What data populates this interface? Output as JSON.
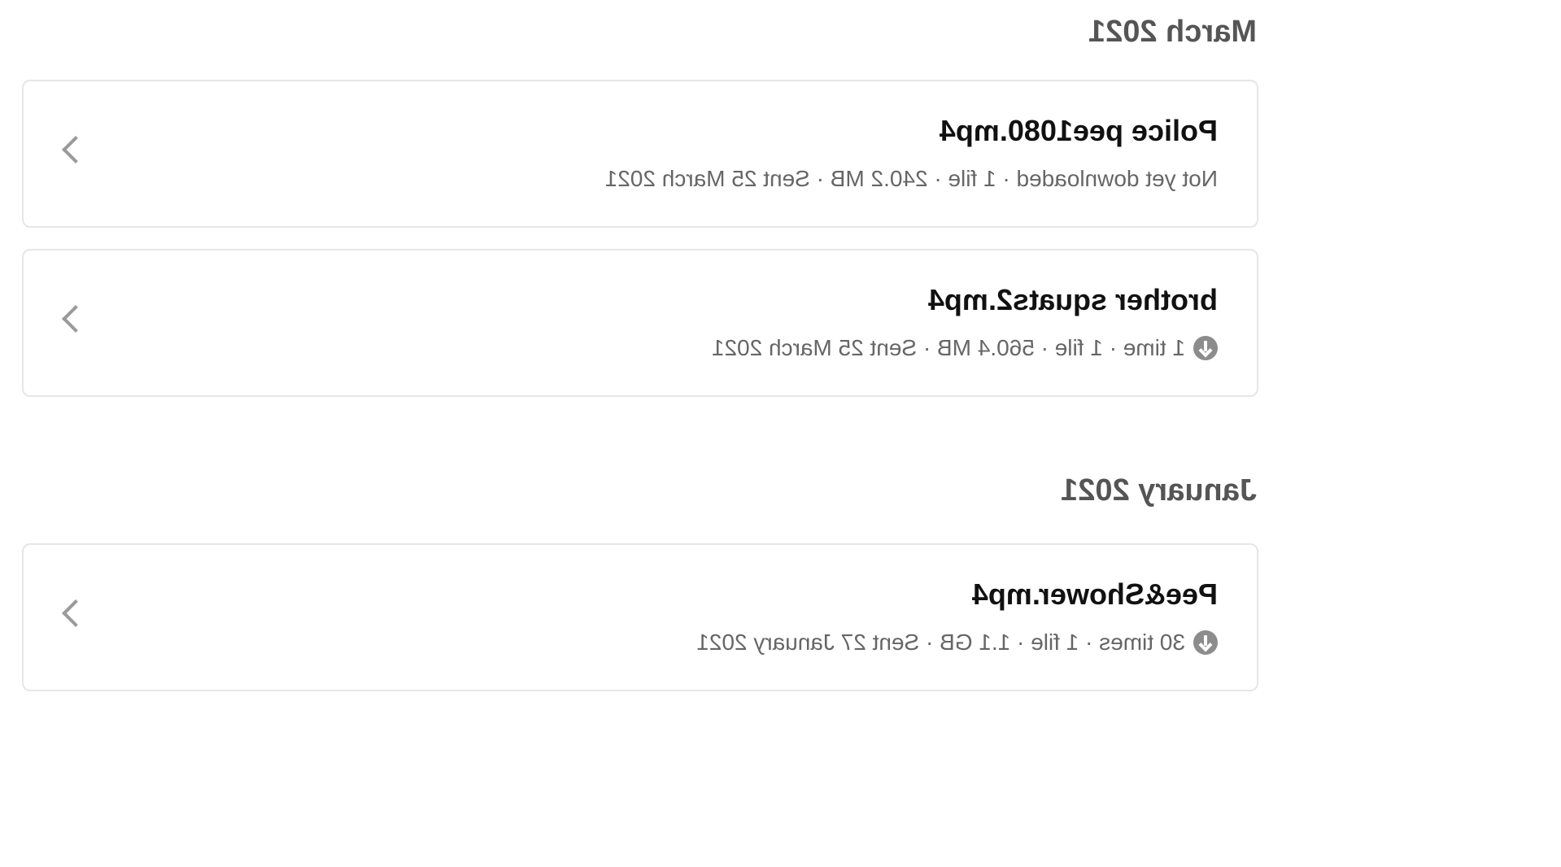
{
  "groups": [
    {
      "heading": "March 2021",
      "items": [
        {
          "title": "Police pee1080.mp4",
          "meta": "Not yet downloaded · 1 file · 240.2 MB · Sent 25 March 2021",
          "has_download_icon": false
        },
        {
          "title": "brother squats2.mp4",
          "meta": "1 time · 1 file · 560.4 MB · Sent 25 March 2021",
          "has_download_icon": true
        }
      ]
    },
    {
      "heading": "January 2021",
      "items": [
        {
          "title": "Pee&Shower.mp4",
          "meta": "30 times · 1 file · 1.1 GB · Sent 27 January 2021",
          "has_download_icon": true
        }
      ]
    }
  ],
  "icons": {
    "download": "download-circle-icon",
    "chevron": "chevron-right-icon"
  },
  "colors": {
    "heading": "#555555",
    "title": "#111111",
    "meta": "#666666",
    "border": "#e6e6e6",
    "icon": "#8c8c8c"
  }
}
